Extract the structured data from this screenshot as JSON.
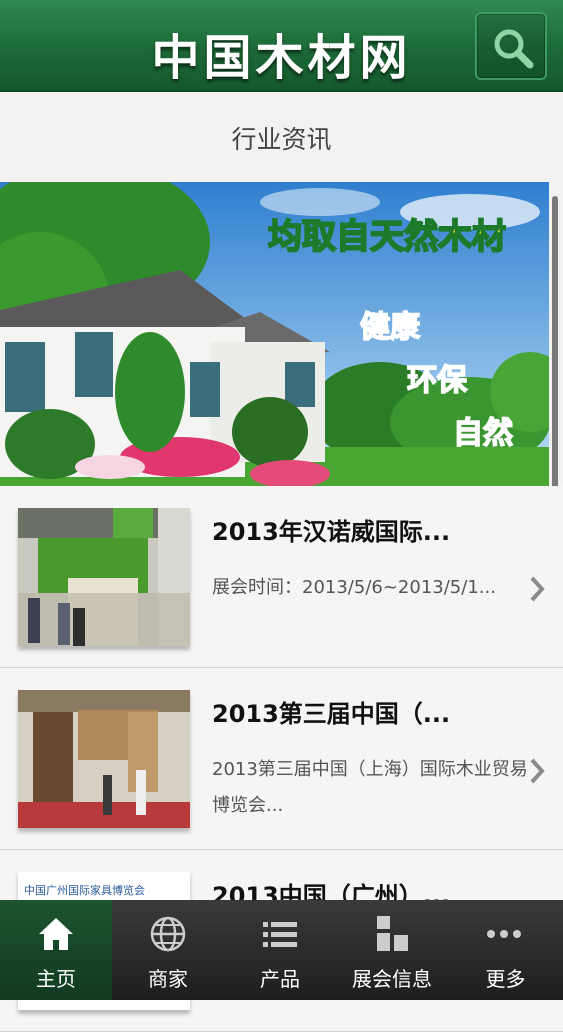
{
  "header": {
    "title": "中国木材网",
    "search_icon": "search-icon"
  },
  "section": {
    "title": "行业资讯"
  },
  "banner": {
    "headline": "均取自天然木材",
    "taglines": [
      "健康",
      "环保",
      "自然"
    ]
  },
  "news": [
    {
      "title": "2013年汉诺威国际...",
      "desc": "展会时间：2013/5/6~2013/5/1..."
    },
    {
      "title": "2013第三届中国（...",
      "desc": "2013第三届中国（上海）国际木业贸易博览会..."
    },
    {
      "title": "2013中国（广州）...",
      "desc": ""
    }
  ],
  "thumb3_caption": "中国广州国际家具博览会",
  "nav": [
    {
      "label": "主页",
      "icon": "home-icon",
      "active": true
    },
    {
      "label": "商家",
      "icon": "globe-icon",
      "active": false
    },
    {
      "label": "产品",
      "icon": "list-icon",
      "active": false
    },
    {
      "label": "展会信息",
      "icon": "grid-icon",
      "active": false
    },
    {
      "label": "更多",
      "icon": "more-icon",
      "active": false
    }
  ],
  "colors": {
    "header": "#1c6a37",
    "accent_banner_text": "#e8262a"
  }
}
